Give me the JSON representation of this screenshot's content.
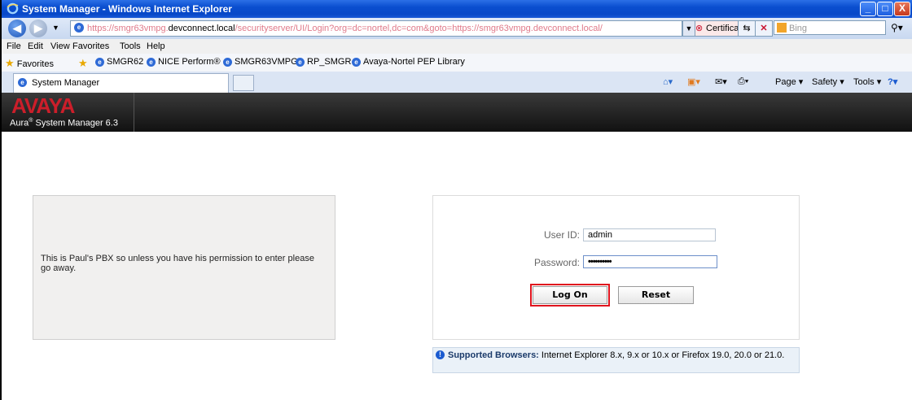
{
  "window": {
    "title": "System Manager - Windows Internet Explorer",
    "minimize": "_",
    "maximize": "□",
    "close": "X"
  },
  "address": {
    "url_prefix": "https://smgr63vmpg.",
    "url_host": "devconnect.local",
    "url_rest": "/securityserver/UI/Login?org=dc=nortel,dc=com&goto=https://smgr63vmpg.devconnect.local/",
    "cert_error": "Certificate Error",
    "search_placeholder": "Bing"
  },
  "menu": [
    "File",
    "Edit",
    "View",
    "Favorites",
    "Tools",
    "Help"
  ],
  "favorites": {
    "label": "Favorites",
    "items": [
      "SMGR62",
      "NICE Perform®",
      "SMGR63VMPG",
      "RP_SMGR",
      "Avaya-Nortel PEP Library"
    ]
  },
  "tab": {
    "label": "System Manager"
  },
  "commands": {
    "page": "Page ▾",
    "safety": "Safety ▾",
    "tools": "Tools ▾"
  },
  "header": {
    "logo": "AVAYA",
    "product": "Aura",
    "product_sup": "®",
    "product_rest": " System Manager 6.3"
  },
  "notice": {
    "text": "This is Paul's PBX so unless you have his permission to enter please go away."
  },
  "login": {
    "userid_label": "User ID:",
    "userid_value": "admin",
    "password_label": "Password:",
    "password_value": "••••••••••",
    "logon_label": "Log On",
    "reset_label": "Reset"
  },
  "browsers": {
    "heading": "Supported Browsers:",
    "text": " Internet Explorer 8.x, 9.x or 10.x or Firefox 19.0, 20.0 or 21.0."
  },
  "colors": {
    "accent_red": "#cc1e2a",
    "highlight": "#e0141e",
    "titlebar": "#0a4ecf"
  }
}
